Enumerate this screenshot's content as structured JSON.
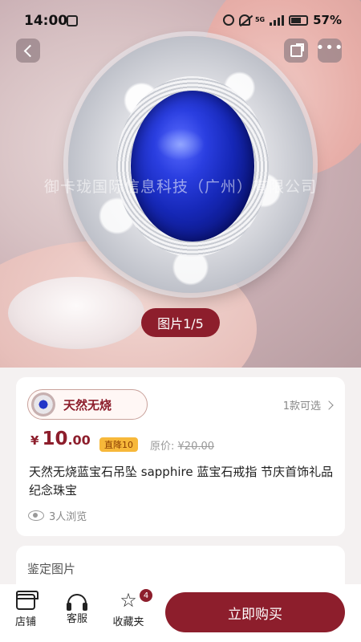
{
  "status_bar": {
    "time": "14:00",
    "network": "5G",
    "battery": "57%"
  },
  "hero": {
    "watermark": "御卡珑国际信息科技（广州）有限公司",
    "image_counter": "图片1/5"
  },
  "product": {
    "tag_label": "天然无烧",
    "options_text": "1款可选",
    "price_currency": "¥",
    "price_integer": "10",
    "price_decimal": ".00",
    "drop_badge": "直降10",
    "original_label": "原价:",
    "original_price": "¥20.00",
    "title": "天然无烧蓝宝石吊坠 sapphire 蓝宝石戒指 节庆首饰礼品 纪念珠宝",
    "views": "3人浏览"
  },
  "appraisal": {
    "title": "鉴定图片"
  },
  "bottom_bar": {
    "store": "店铺",
    "service": "客服",
    "favorites": "收藏夹",
    "favorites_count": "4",
    "buy_now": "立即购买"
  },
  "colors": {
    "accent": "#8d1e2c",
    "badge": "#f7b83a",
    "sapphire": "#1628b8"
  },
  "icons": [
    "back-icon",
    "share-icon",
    "more-icon",
    "chevron-right-icon",
    "eye-icon",
    "store-icon",
    "headset-icon",
    "star-icon"
  ]
}
